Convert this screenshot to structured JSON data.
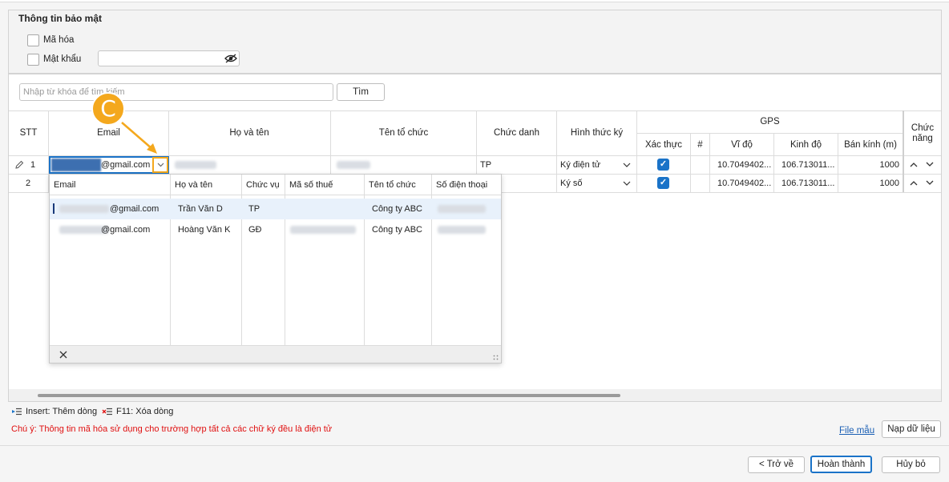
{
  "security": {
    "title": "Thông tin bảo mật",
    "encrypt_label": "Mã hóa",
    "password_label": "Mật khẩu",
    "password_value": ""
  },
  "search": {
    "placeholder": "Nhập từ khóa để tìm kiếm",
    "button": "Tìm"
  },
  "grid": {
    "headers": {
      "stt": "STT",
      "email": "Email",
      "fullname": "Họ và tên",
      "org": "Tên tổ chức",
      "position": "Chức danh",
      "sign_type": "Hình thức ký",
      "gps": "GPS",
      "verify": "Xác thực",
      "hash": "#",
      "lat": "Vĩ độ",
      "lng": "Kinh độ",
      "radius": "Bán kính (m)",
      "func": "Chức năng"
    },
    "rows": [
      {
        "stt": "1",
        "email_suffix": "@gmail.com",
        "position": "TP",
        "sign_type": "Ký điện tử",
        "lat": "10.7049402...",
        "lng": "106.713011...",
        "radius": "1000"
      },
      {
        "stt": "2",
        "email_suffix": "",
        "position": "",
        "sign_type": "Ký số",
        "lat": "10.7049402...",
        "lng": "106.713011...",
        "radius": "1000"
      }
    ]
  },
  "dropdown": {
    "columns": [
      "Email",
      "Họ và tên",
      "Chức vụ",
      "Mã số thuế",
      "Tên tổ chức",
      "Số điện thoại"
    ],
    "rows": [
      {
        "email_suffix": "@gmail.com",
        "name": "Trần Văn D",
        "role": "TP",
        "org": "Công ty ABC"
      },
      {
        "email_suffix": "@gmail.com",
        "name": "Hoàng Văn K",
        "role": "GĐ",
        "org": "Công ty ABC"
      }
    ]
  },
  "callout": {
    "letter": "C",
    "color": "#f4a81d"
  },
  "shortcuts": {
    "insert": "Insert: Thêm dòng",
    "delete": "F11: Xóa dòng"
  },
  "note": "Chú ý: Thông tin mã hóa sử dụng cho trường hợp tất cả các chữ ký đều là điện tử",
  "actions": {
    "sample_file": "File mẫu",
    "load_data": "Nạp dữ liệu",
    "back": "< Trở về",
    "finish": "Hoàn thành",
    "cancel": "Hủy bỏ"
  },
  "colors": {
    "accent": "#1a73c8",
    "note": "#e01010",
    "callout": "#f4a81d"
  }
}
